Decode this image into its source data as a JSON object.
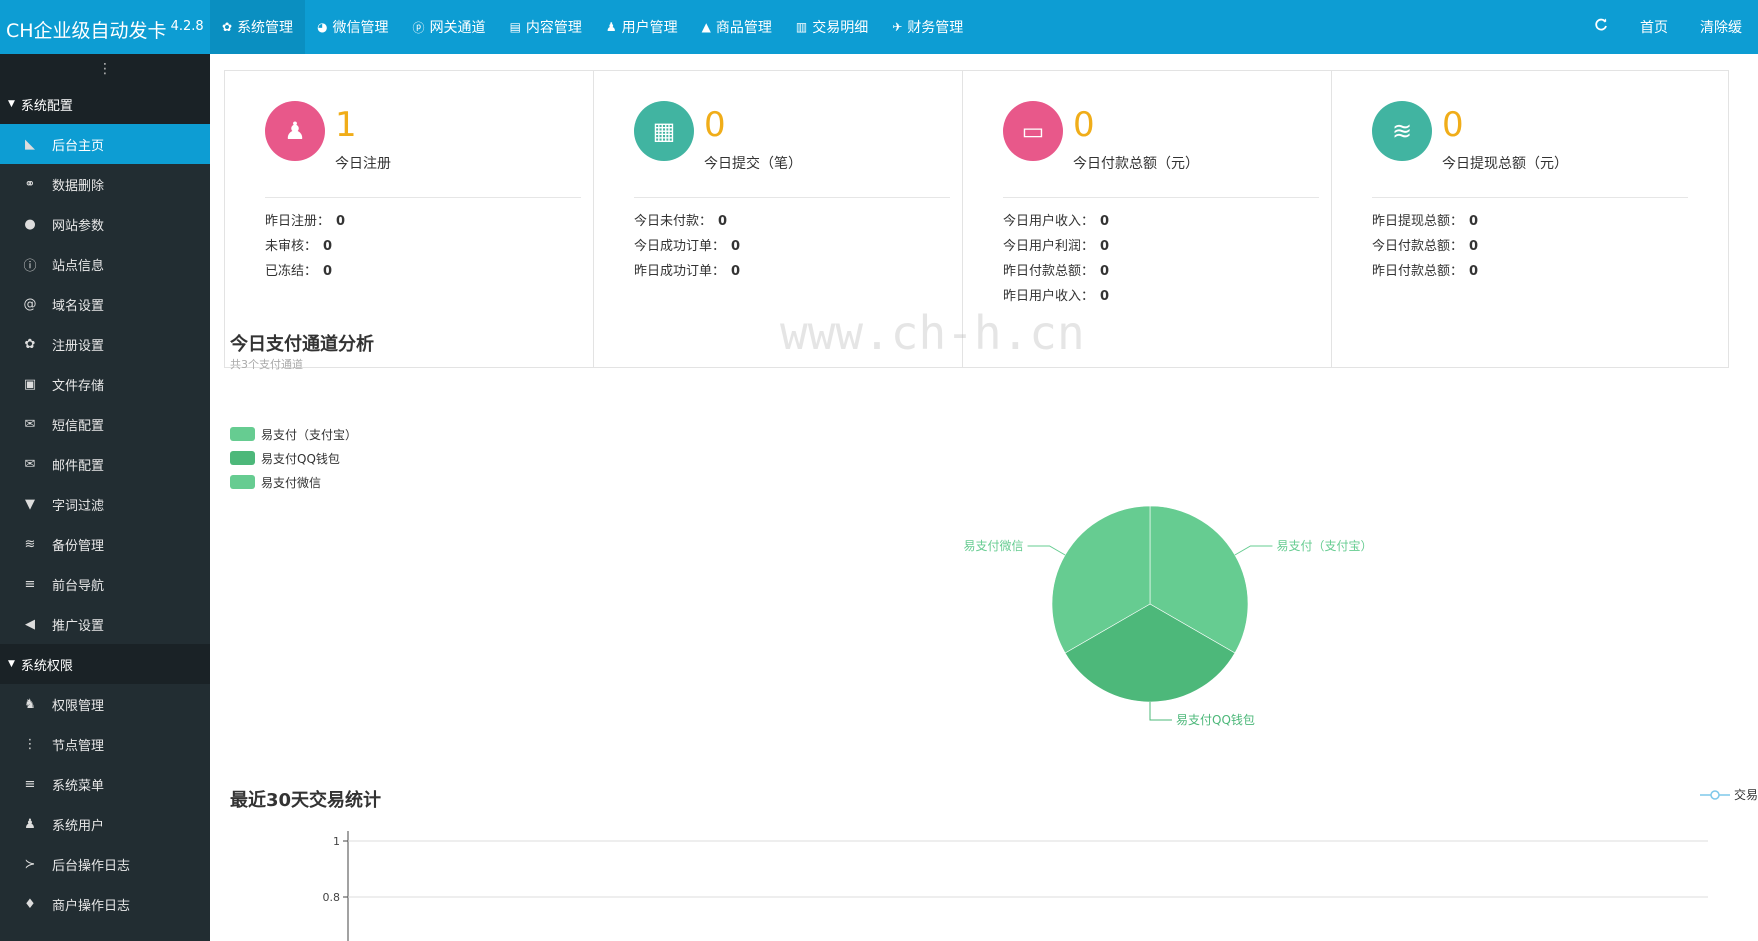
{
  "app": {
    "title": "CH企业级自动发卡",
    "version": "4.2.8"
  },
  "topnav": {
    "items": [
      {
        "label": "系统管理",
        "icon": "gear-icon"
      },
      {
        "label": "微信管理",
        "icon": "wechat-icon"
      },
      {
        "label": "网关通道",
        "icon": "paypal-icon"
      },
      {
        "label": "内容管理",
        "icon": "file-icon"
      },
      {
        "label": "用户管理",
        "icon": "users-icon"
      },
      {
        "label": "商品管理",
        "icon": "bag-icon"
      },
      {
        "label": "交易明细",
        "icon": "bar-chart-icon"
      },
      {
        "label": "财务管理",
        "icon": "money-icon"
      }
    ],
    "refresh_icon": "refresh-icon",
    "home_label": "首页",
    "clear_label": "清除缓"
  },
  "sidebar": {
    "toggle": "⋮",
    "groups": [
      {
        "label": "系统配置",
        "items": [
          {
            "label": "后台主页",
            "icon": "area-chart-icon"
          },
          {
            "label": "数据删除",
            "icon": "link-icon"
          },
          {
            "label": "网站参数",
            "icon": "apple-icon"
          },
          {
            "label": "站点信息",
            "icon": "info-icon"
          },
          {
            "label": "域名设置",
            "icon": "at-icon"
          },
          {
            "label": "注册设置",
            "icon": "gear-icon"
          },
          {
            "label": "文件存储",
            "icon": "save-icon"
          },
          {
            "label": "短信配置",
            "icon": "envelope-icon"
          },
          {
            "label": "邮件配置",
            "icon": "envelope-icon"
          },
          {
            "label": "字词过滤",
            "icon": "filter-icon"
          },
          {
            "label": "备份管理",
            "icon": "database-icon"
          },
          {
            "label": "前台导航",
            "icon": "menu-icon"
          },
          {
            "label": "推广设置",
            "icon": "bullhorn-icon"
          }
        ]
      },
      {
        "label": "系统权限",
        "items": [
          {
            "label": "权限管理",
            "icon": "user-secret-icon"
          },
          {
            "label": "节点管理",
            "icon": "ellipsis-icon"
          },
          {
            "label": "系统菜单",
            "icon": "menu-icon"
          },
          {
            "label": "系统用户",
            "icon": "users-icon"
          },
          {
            "label": "后台操作日志",
            "icon": "terminal-icon"
          },
          {
            "label": "商户操作日志",
            "icon": "pin-icon"
          }
        ]
      }
    ]
  },
  "cards": [
    {
      "value": "1",
      "label": "今日注册",
      "color": "#e8588a",
      "icon": "users-icon",
      "stats": [
        {
          "k": "昨日注册：",
          "v": "0"
        },
        {
          "k": "未审核：",
          "v": "0"
        },
        {
          "k": "已冻结：",
          "v": "0"
        }
      ]
    },
    {
      "value": "0",
      "label": "今日提交（笔）",
      "color": "#41b4a1",
      "icon": "calendar-icon",
      "stats": [
        {
          "k": "今日未付款：",
          "v": "0"
        },
        {
          "k": "今日成功订单：",
          "v": "0"
        },
        {
          "k": "昨日成功订单：",
          "v": "0"
        }
      ]
    },
    {
      "value": "0",
      "label": "今日付款总额（元）",
      "color": "#e8588a",
      "icon": "credit-card-icon",
      "stats": [
        {
          "k": "今日用户收入：",
          "v": "0"
        },
        {
          "k": "今日用户利润：",
          "v": "0"
        },
        {
          "k": "昨日付款总额：",
          "v": "0"
        },
        {
          "k": "昨日用户收入：",
          "v": "0"
        }
      ]
    },
    {
      "value": "0",
      "label": "今日提现总额（元）",
      "color": "#41b4a1",
      "icon": "database-icon",
      "stats": [
        {
          "k": "昨日提现总额：",
          "v": "0"
        },
        {
          "k": "今日付款总额：",
          "v": "0"
        },
        {
          "k": "昨日付款总额：",
          "v": "0"
        }
      ]
    }
  ],
  "watermark": "www.ch-h.cn",
  "pie_section": {
    "title": "今日支付通道分析",
    "subtitle": "共3个支付通道"
  },
  "line_section": {
    "title": "最近30天交易统计",
    "legend": "交易"
  },
  "chart_data": [
    {
      "type": "pie",
      "title": "今日支付通道分析",
      "series": [
        {
          "name": "易支付（支付宝）",
          "value": 1,
          "color": "#66cc91"
        },
        {
          "name": "易支付QQ钱包",
          "value": 1,
          "color": "#4db87a"
        },
        {
          "name": "易支付微信",
          "value": 1,
          "color": "#66cc91"
        }
      ]
    },
    {
      "type": "line",
      "title": "最近30天交易统计",
      "series": [
        {
          "name": "交易",
          "values": []
        }
      ],
      "yticks": [
        "1",
        "0.8"
      ],
      "ylim": [
        0,
        1
      ],
      "grid": true,
      "legend": "top-right"
    }
  ]
}
